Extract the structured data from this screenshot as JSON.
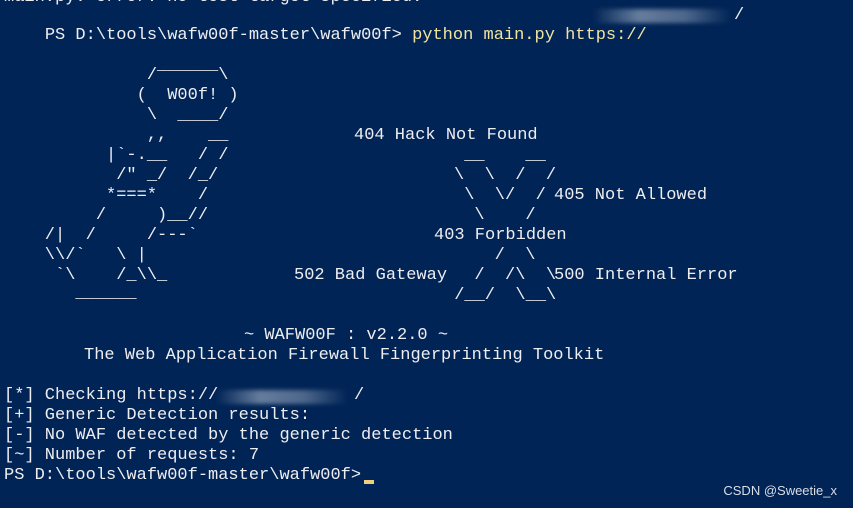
{
  "terminal": {
    "prev_output": "main.py: error: no test target specified.",
    "command_prompt": "PS D:\\tools\\wafw00f-master\\wafw00f>",
    "command_text": "python main.py https://",
    "command_url_tail": "/",
    "ascii_art": [
      "               ______",
      "              /      \\",
      "             (  W00f! )",
      "              \\  ____/",
      "              ,,    __",
      "          |`-.__   / /",
      "           /\" _/  /_/",
      "          *===*    /",
      "         /     )__//",
      "    /|  /     /---`",
      "    \\\\/`   \\ |",
      "     `\\    /_\\\\_",
      "       ______"
    ],
    "waf_messages": {
      "hack_not_found": "404 Hack Not Found",
      "not_allowed": "405 Not Allowed",
      "forbidden": "403 Forbidden",
      "bad_gateway": "502 Bad Gateway",
      "internal_error": "500 Internal Error"
    },
    "x_art": [
      " __    __",
      "\\  \\  /  /",
      " \\  \\/  /",
      "  \\    /",
      "   /  \\",
      "  /  /\\  \\",
      " /__/  \\__\\"
    ],
    "banner_title": "~ WAFW00F : v2.2.0 ~",
    "banner_subtitle": "The Web Application Firewall Fingerprinting Toolkit",
    "checking_prefix": "[*] Checking https://",
    "checking_tail": "/",
    "results": [
      "[+] Generic Detection results:",
      "[-] No WAF detected by the generic detection",
      "[~] Number of requests: 7"
    ],
    "final_prompt": "PS D:\\tools\\wafw00f-master\\wafw00f>"
  },
  "watermark": "CSDN @Sweetie_x",
  "colors": {
    "background": "#012456",
    "text": "#eeedf0",
    "command": "#f2e3a0",
    "cursor": "#f2cf7d"
  }
}
